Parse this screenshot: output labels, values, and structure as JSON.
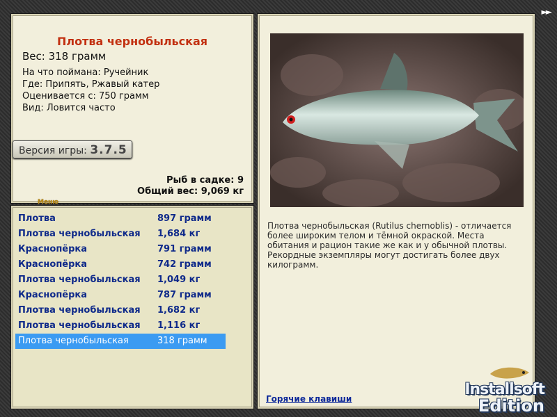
{
  "fish": {
    "name": "Плотва чернобыльская",
    "weight": "Вес: 318 грамм",
    "caught_on": "На что поймана: Ручейник",
    "location": "Где: Припять, Ржавый катер",
    "value": "Оценивается с: 750 грамм",
    "frequency": "Вид: Ловится часто"
  },
  "version": {
    "label": "Версия игры:",
    "number": "3.7.5"
  },
  "menu_label": "Меню",
  "stats": {
    "count": "Рыб в садке: 9",
    "total": "Общий вес: 9,069 кг"
  },
  "catch": [
    {
      "name": "Плотва",
      "weight": "897 грамм"
    },
    {
      "name": "Плотва чернобыльская",
      "weight": "1,684 кг"
    },
    {
      "name": "Краснопёрка",
      "weight": "791 грамм"
    },
    {
      "name": "Краснопёрка",
      "weight": "742 грамм"
    },
    {
      "name": "Плотва чернобыльская",
      "weight": "1,049 кг"
    },
    {
      "name": "Краснопёрка",
      "weight": "787 грамм"
    },
    {
      "name": "Плотва чернобыльская",
      "weight": "1,682 кг"
    },
    {
      "name": "Плотва чернобыльская",
      "weight": "1,116 кг"
    },
    {
      "name": "Плотва чернобыльская",
      "weight": "318 грамм"
    }
  ],
  "selected_index": 8,
  "description": "Плотва чернобыльская (Rutilus chernoblis) - отличается более широким телом и тёмной окраской. Места обитания и рацион такие же как и у обычной плотвы. Рекордные экземпляры могут достигать более двух килограмм.",
  "hotkeys_label": "Горячие клавиши",
  "next_button": "►►",
  "logo": {
    "line1": "Installsoft",
    "line2": "Edition"
  }
}
